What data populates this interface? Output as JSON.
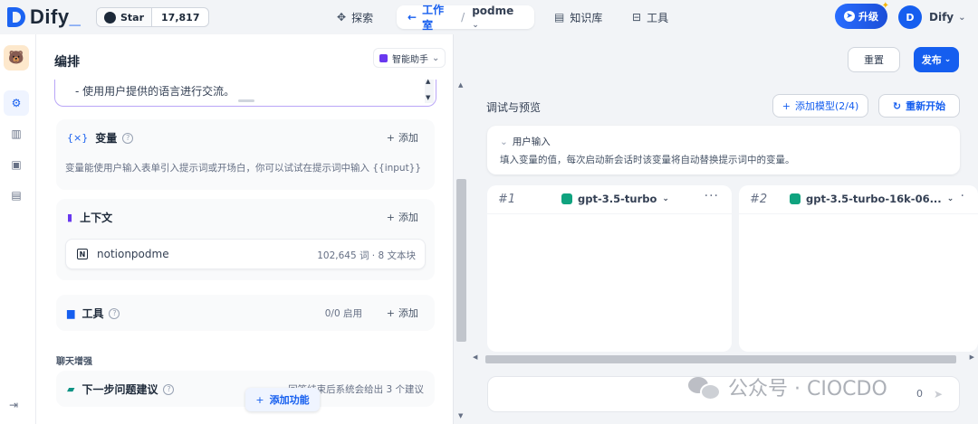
{
  "topbar": {
    "logo_text": "Dify",
    "github": {
      "star_label": "Star",
      "count": "17,817"
    },
    "nav": {
      "explore": "探索",
      "studio": "工作室",
      "separator": "/",
      "app_name": "podme",
      "knowledge": "知识库",
      "tools": "工具"
    },
    "upgrade_label": "升级",
    "user": {
      "initial": "D",
      "name": "Dify"
    }
  },
  "icons": {
    "explore": "compass-icon",
    "studio": "arrow-left-icon",
    "knowledge": "book-icon",
    "tools": "toolbox-icon"
  },
  "orchestrate": {
    "title": "编排",
    "assistant_label": "智能助手",
    "prompt_line": "- 使用用户提供的语言进行交流。",
    "variables": {
      "title": "变量",
      "add": "添加",
      "desc": "变量能使用户输入表单引入提示词或开场白，你可以试试在提示词中输入 {{input}}"
    },
    "context": {
      "title": "上下文",
      "add": "添加",
      "kb_name": "notionpodme",
      "kb_meta": "102,645 词 · 8 文本块"
    },
    "tools": {
      "title": "工具",
      "status": "0/0 启用",
      "add": "添加"
    },
    "chat_enhance_label": "聊天增强",
    "suggestion": {
      "title": "下一步问题建议",
      "desc": "回答结束后系统会给出 3 个建议"
    },
    "add_feature": "添加功能"
  },
  "actions": {
    "reset": "重置",
    "publish": "发布"
  },
  "debug": {
    "title": "调试与预览",
    "add_model": "添加模型(2/4)",
    "restart": "重新开始",
    "user_input_title": "用户输入",
    "user_input_desc": "填入变量的值，每次启动新会话时该变量将自动替换提示词中的变量。",
    "models": [
      {
        "num": "#1",
        "name": "gpt-3.5-turbo"
      },
      {
        "num": "#2",
        "name": "gpt-3.5-turbo-16k-06..."
      }
    ],
    "char_count": "0"
  },
  "watermark": "公众号 · CIOCDO"
}
